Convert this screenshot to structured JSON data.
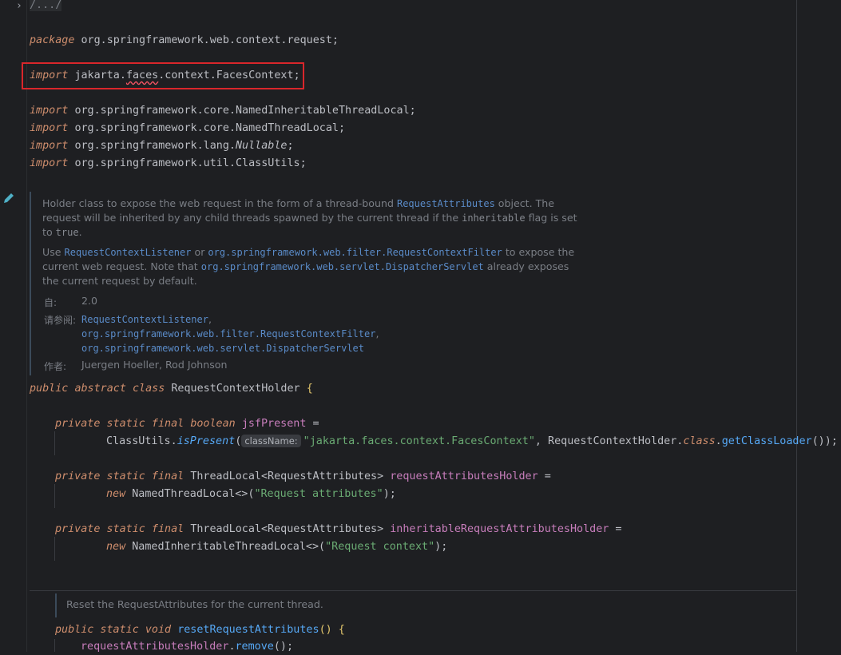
{
  "fold": {
    "label": "/.../"
  },
  "code": {
    "package_kw": "package",
    "package_name": "org.springframework.web.context.request",
    "import_kw": "import",
    "imports": [
      {
        "pre": "jakarta.",
        "wavy": "faces",
        "post": ".context.FacesContext"
      },
      {
        "pre": "org.springframework.core.NamedInheritableThreadLocal",
        "wavy": "",
        "post": ""
      },
      {
        "pre": "org.springframework.core.NamedThreadLocal",
        "wavy": "",
        "post": ""
      },
      {
        "pre": "org.springframework.lang.",
        "wavy": "",
        "post": ""
      },
      {
        "pre": "org.springframework.util.ClassUtils",
        "wavy": "",
        "post": ""
      }
    ],
    "nullable": "Nullable",
    "class_decl": {
      "kw1": "public",
      "kw2": "abstract",
      "kw3": "class",
      "name": "RequestContextHolder",
      "brace": "{"
    },
    "field1": {
      "kws": "private static final",
      "type": "boolean",
      "name": "jsfPresent",
      "eq": "="
    },
    "field1_init": {
      "cls": "ClassUtils",
      "method": "isPresent",
      "hint": "className:",
      "str": "\"jakarta.faces.context.FacesContext\"",
      "cls2": "RequestContextHolder",
      "kw": "class",
      "method2": "getClassLoader",
      "end": "());"
    },
    "field2": {
      "kws": "private static final",
      "type": "ThreadLocal<RequestAttributes>",
      "name": "requestAttributesHolder",
      "eq": "="
    },
    "field2_init": {
      "kw": "new",
      "cls": "NamedThreadLocal<>",
      "str": "\"Request attributes\"",
      "end": ");"
    },
    "field3": {
      "kws": "private static final",
      "type": "ThreadLocal<RequestAttributes>",
      "name": "inheritableRequestAttributesHolder",
      "eq": "="
    },
    "field3_init": {
      "kw": "new",
      "cls": "NamedInheritableThreadLocal<>",
      "str": "\"Request context\"",
      "end": ");"
    },
    "method": {
      "kws": "public static void",
      "name": "resetRequestAttributes",
      "rest": "() {"
    },
    "method_body": {
      "field": "requestAttributesHolder",
      "call": "remove",
      "end": "();"
    }
  },
  "doc": {
    "p1_l1_a": "Holder class to expose the web request in the form of a thread-bound ",
    "p1_l1_link": "RequestAttributes",
    "p1_l1_b": " object. The",
    "p1_l2_a": "request will be inherited by any child threads spawned by the current thread if the ",
    "p1_l2_code": "inheritable",
    "p1_l2_b": " flag is set",
    "p1_l3_a": "to ",
    "p1_l3_code": "true",
    "p1_l3_b": ".",
    "p2_l1_a": "Use ",
    "p2_l1_link1": "RequestContextListener",
    "p2_l1_b": " or ",
    "p2_l1_link2": "org.springframework.web.filter.RequestContextFilter",
    "p2_l1_c": " to expose the",
    "p2_l2_a": "current web request. Note that ",
    "p2_l2_link": "org.springframework.web.servlet.DispatcherServlet",
    "p2_l2_b": " already exposes",
    "p2_l3": "the current request by default.",
    "since_label": "自:",
    "since_value": "2.0",
    "see_label": "请参阅:",
    "see_1": "RequestContextListener",
    "see_1_sep": ",",
    "see_2": "org.springframework.web.filter.RequestContextFilter",
    "see_2_sep": ",",
    "see_3": "org.springframework.web.servlet.DispatcherServlet",
    "author_label": "作者:",
    "author_value": "Juergen Hoeller, Rod Johnson",
    "reset_doc": "Reset the RequestAttributes for the current thread."
  },
  "colors": {
    "highlight_border": "#d9262b",
    "keyword": "#cf8e6d",
    "string": "#6aab73",
    "method": "#56a8f5",
    "field": "#c77dbb"
  }
}
